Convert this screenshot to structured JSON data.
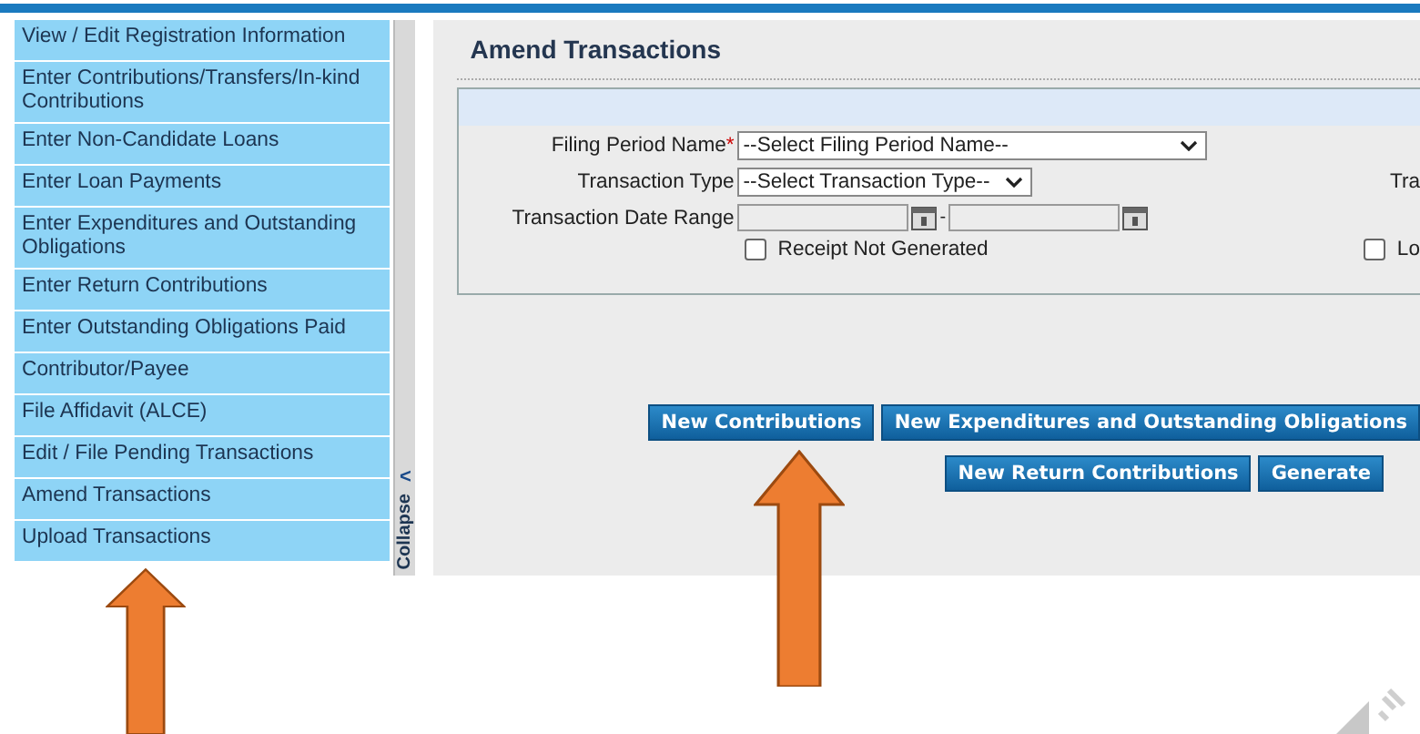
{
  "sidebar": {
    "items": [
      {
        "label": "View / Edit Registration Information",
        "selected": false
      },
      {
        "label": "Enter Contributions/Transfers/In-kind Contributions",
        "selected": false
      },
      {
        "label": "Enter Non-Candidate Loans",
        "selected": false
      },
      {
        "label": "Enter Loan Payments",
        "selected": false
      },
      {
        "label": "Enter Expenditures and Outstanding Obligations",
        "selected": false
      },
      {
        "label": "Enter Return Contributions",
        "selected": false
      },
      {
        "label": "Enter Outstanding Obligations Paid",
        "selected": false
      },
      {
        "label": "Contributor/Payee",
        "selected": false
      },
      {
        "label": "File Affidavit (ALCE)",
        "selected": false
      },
      {
        "label": "Edit / File Pending Transactions",
        "selected": false
      },
      {
        "label": "Amend Transactions",
        "selected": false
      },
      {
        "label": "Upload Transactions",
        "selected": false
      }
    ],
    "collapse": {
      "label": "Collapse",
      "arrow": "<"
    }
  },
  "main": {
    "title": "Amend Transactions",
    "form": {
      "filing_period": {
        "label": "Filing Period Name",
        "required_mark": "*",
        "value": "--Select Filing Period Name--"
      },
      "transaction_type": {
        "label": "Transaction Type",
        "value": "--Select Transaction Type--"
      },
      "date_range": {
        "label": "Transaction Date Range",
        "separator": "-"
      },
      "receipt_not_generated": {
        "label": "Receipt Not Generated",
        "checked": false
      },
      "right_label": "Tra",
      "right_checkbox": {
        "label": "Lo",
        "checked": false
      }
    },
    "buttons_row_1": [
      "New Contributions",
      "New Expenditures and Outstanding Obligations"
    ],
    "buttons_row_2": [
      "New Return Contributions",
      "Generate"
    ]
  },
  "annotations": [
    {
      "kind": "arrow"
    },
    {
      "kind": "arrow"
    }
  ]
}
